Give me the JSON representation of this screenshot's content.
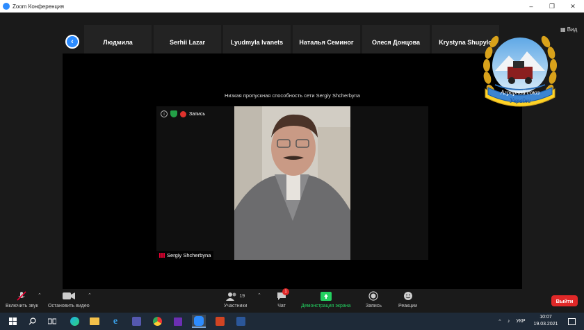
{
  "window": {
    "title": "Zoom Конференция"
  },
  "gallery": {
    "participants": [
      {
        "name": "Людмила"
      },
      {
        "name": "Serhii Lazar"
      },
      {
        "name": "Lyudmyla Ivanets"
      },
      {
        "name": "Наталья Семиног"
      },
      {
        "name": "Олеся Донцова"
      },
      {
        "name": "Krystyna Shupylo"
      }
    ],
    "view_label": "Вид"
  },
  "main": {
    "bandwidth_notice": "Низкая пропускная способность сети Sergiy Shcherbyna",
    "recording_label": "Запись",
    "speaker_name": "Sergiy Shcherbyna"
  },
  "logo": {
    "text_line1": "Аграрний союз",
    "text_line2": "України"
  },
  "toolbar": {
    "unmute_label": "Включить звук",
    "stop_video_label": "Остановить видео",
    "participants_label": "Участники",
    "participants_count": "19",
    "chat_label": "Чат",
    "chat_badge": "1",
    "share_label": "Демонстрация экрана",
    "record_label": "Запись",
    "reactions_label": "Реакции",
    "leave_label": "Выйти"
  },
  "taskbar": {
    "lang": "УКР",
    "time": "10:07",
    "date": "19.03.2021"
  },
  "colors": {
    "accent": "#2d8cff",
    "leave": "#e02828",
    "share": "#23d160",
    "background": "#1a1a1a"
  }
}
